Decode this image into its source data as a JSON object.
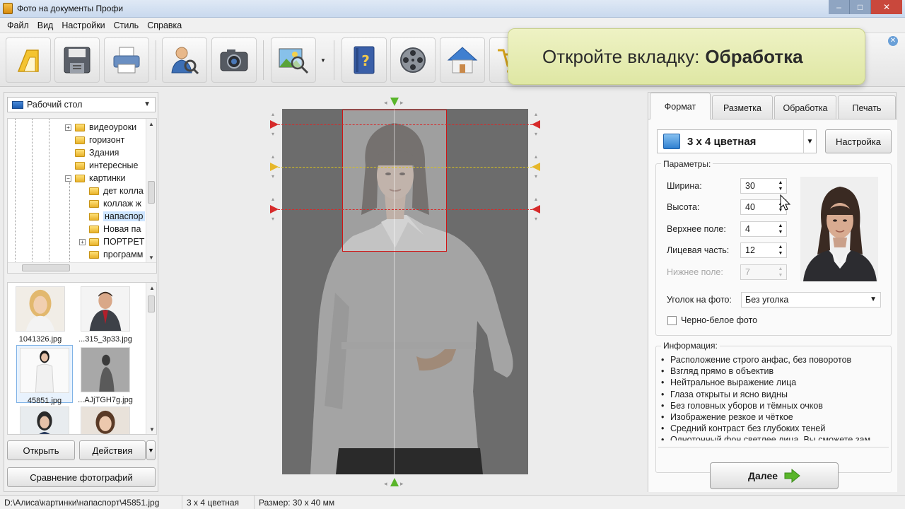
{
  "window": {
    "title": "Фото на документы Профи"
  },
  "menu": [
    "Файл",
    "Вид",
    "Настройки",
    "Стиль",
    "Справка"
  ],
  "toolbar": {
    "buttons": [
      "home-icon",
      "save-icon",
      "print-icon",
      "user-search-icon",
      "camera-icon",
      "photo-zoom-icon",
      "help-book-icon",
      "film-reel-icon",
      "house-icon",
      "cart-icon"
    ]
  },
  "hint": {
    "text": "Откройте вкладку:",
    "bold": "Обработка"
  },
  "left": {
    "folder": "Рабочий стол",
    "tree": [
      {
        "label": "видеоуроки",
        "expander": "+"
      },
      {
        "label": "горизонт",
        "expander": ""
      },
      {
        "label": "Здания",
        "expander": ""
      },
      {
        "label": "интересные",
        "expander": ""
      },
      {
        "label": "картинки",
        "expander": "−"
      },
      {
        "label": "дет колла",
        "expander": ""
      },
      {
        "label": "коллаж ж",
        "expander": ""
      },
      {
        "label": "напаспор",
        "expander": "",
        "selected": true
      },
      {
        "label": "Новая па",
        "expander": ""
      },
      {
        "label": "ПОРТРЕТ",
        "expander": "+"
      },
      {
        "label": "программ",
        "expander": ""
      }
    ],
    "thumbs": [
      {
        "caption": "1041326.jpg"
      },
      {
        "caption": "...315_3p33.jpg"
      },
      {
        "caption": "45851.jpg",
        "selected": true
      },
      {
        "caption": "...AJjTGH7g.jpg"
      },
      {
        "caption": ""
      },
      {
        "caption": ""
      }
    ],
    "open_label": "Открыть",
    "actions_label": "Действия",
    "compare_label": "Сравнение фотографий"
  },
  "tabs": [
    "Формат",
    "Разметка",
    "Обработка",
    "Печать"
  ],
  "format": {
    "selected": "3 х 4 цветная",
    "settings_label": "Настройка",
    "params_title": "Параметры:",
    "params": [
      {
        "label": "Ширина:",
        "value": "30",
        "disabled": false
      },
      {
        "label": "Высота:",
        "value": "40",
        "disabled": false
      },
      {
        "label": "Верхнее поле:",
        "value": "4",
        "disabled": false
      },
      {
        "label": "Лицевая часть:",
        "value": "12",
        "disabled": false
      },
      {
        "label": "Нижнее поле:",
        "value": "7",
        "disabled": true
      }
    ],
    "corner_label": "Уголок на фото:",
    "corner_value": "Без уголка",
    "bw_label": "Черно-белое фото",
    "info_title": "Информация:",
    "info": [
      "Расположение строго анфас, без поворотов",
      "Взгляд прямо в объектив",
      "Нейтральное выражение лица",
      "Глаза открыты и ясно видны",
      "Без головных уборов и тёмных очков",
      "Изображение резкое и чёткое",
      "Средний контраст без глубоких теней",
      "Однотонный фон светлее лица. Вы сможете зам"
    ],
    "next_label": "Далее"
  },
  "status": {
    "path": "D:\\Алиса\\картинки\\напаспорт\\45851.jpg",
    "format": "3 х 4 цветная",
    "size": "Размер: 30 x 40 мм"
  },
  "colors": {
    "accent_green": "#59b52a",
    "crop_red": "#d01515",
    "guide_yellow": "#d8c21e"
  }
}
